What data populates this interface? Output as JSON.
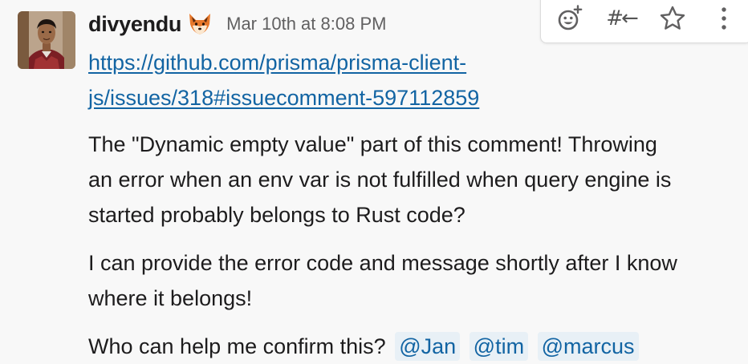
{
  "message": {
    "sender": "divyendu",
    "status_emoji": "fox-emoji",
    "timestamp": "Mar 10th at 8:08 PM",
    "link": {
      "line1": "https://github.com/prisma/prisma-client-",
      "line2": "js/issues/318#issuecomment-597112859"
    },
    "paragraphs": {
      "p1": {
        "line1": "The \"Dynamic empty value\" part of this comment! Throwing",
        "line2": "an error when an env var is not fulfilled when query engine is",
        "line3": "started probably belongs to Rust code?"
      },
      "p2": {
        "line1": "I can provide the error code and message shortly after I know",
        "line2": "where it belongs!"
      },
      "p3": {
        "text": "Who can help me confirm this?"
      }
    },
    "mentions": [
      "@Jan",
      "@tim",
      "@marcus"
    ]
  },
  "actions": {
    "items": [
      {
        "icon": "add-reaction-icon"
      },
      {
        "icon": "reply-in-thread-icon",
        "glyph": "#←"
      },
      {
        "icon": "star-icon"
      },
      {
        "icon": "more-options-icon"
      }
    ]
  },
  "colors": {
    "background": "#f8f8f8",
    "link": "#1264a3",
    "mention_bg": "#e8f0f6",
    "text": "#1d1c1d",
    "muted": "#616061"
  }
}
